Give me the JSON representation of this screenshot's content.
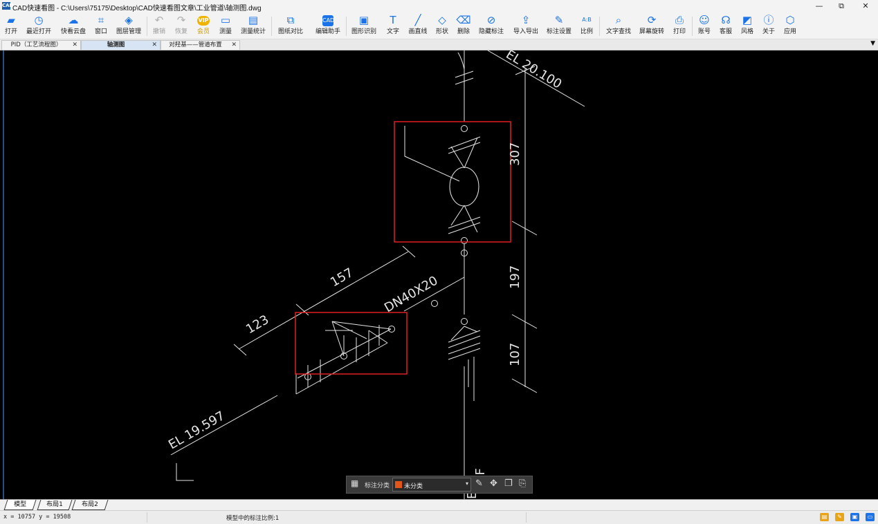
{
  "window": {
    "app_icon_text": "CAD",
    "title": "CAD快速看图 - C:\\Users\\75175\\Desktop\\CAD快速看图文章\\工业管道\\轴测图.dwg",
    "controls": {
      "minimize": "—",
      "restore": "⧉",
      "close": "✕"
    }
  },
  "toolbar": {
    "open": "打开",
    "recent": "最近打开",
    "cloud": "快看云盘",
    "window": "窗口",
    "layers": "图层管理",
    "undo": "撤销",
    "redo": "恢复",
    "vip_badge": "VIP",
    "vip": "会员",
    "measure": "测量",
    "measure_stats": "测量统计",
    "compare": "图纸对比",
    "edit_helper_badge": "CAD",
    "edit_helper": "编辑助手",
    "shape_recognize": "图形识别",
    "text": "文字",
    "line": "画直线",
    "shape": "形状",
    "delete": "删除",
    "hide_annotation": "隐藏标注",
    "import_export": "导入导出",
    "annotation_settings": "标注设置",
    "scale_badge": "A:B",
    "scale": "比例",
    "text_search": "文字查找",
    "rotate_screen": "屏幕旋转",
    "print": "打印",
    "account": "账号",
    "support": "客服",
    "style": "风格",
    "about": "关于",
    "apps": "应用"
  },
  "tabs": [
    {
      "label": "PID（工艺流程图）",
      "active": false
    },
    {
      "label": "轴测图",
      "active": true
    },
    {
      "label": "对羟基——管道布置",
      "active": false
    }
  ],
  "drawing": {
    "texts": {
      "el_top": "EL 20.100",
      "dim_307": "307",
      "dim_197": "197",
      "dim_107": "107",
      "dim_157": "157",
      "dim_123": "123",
      "pipe_spec": "DN40X20",
      "el_bottom": "EL 19.597",
      "bottom_cut_1": "EL",
      "bottom_cut_2": "RF"
    },
    "highlight_color": "#e02020",
    "line_color": "#e6e6e6"
  },
  "annotation_bar": {
    "label": "标注分类",
    "selected": "未分类",
    "swatch_color": "#e2561c"
  },
  "layout_tabs": [
    "模型",
    "布局1",
    "布局2"
  ],
  "status": {
    "coords": "x = 10757  y = 19508",
    "scale_text": "模型中的标注比例:1"
  }
}
